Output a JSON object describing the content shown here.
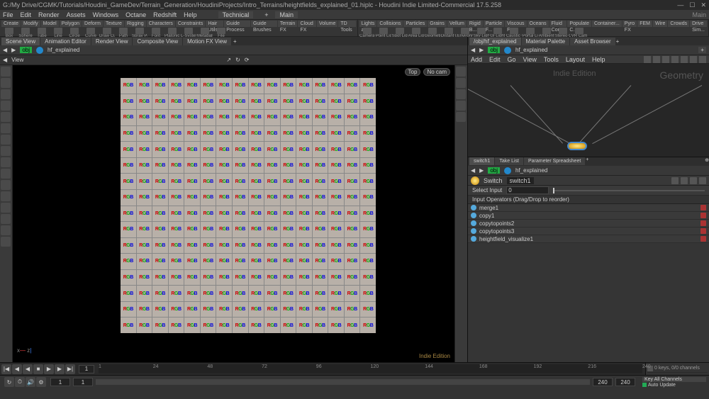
{
  "title": "G:/My Drive/CGMK/Tutorials/Houdini_GameDev/Terrain_Generation/HoudiniProjects/Intro_Terrains/heightfields_explained_01.hiplc - Houdini Indie Limited-Commercial 17.5.258",
  "version_label": "Main",
  "menus": [
    "File",
    "Edit",
    "Render",
    "Assets",
    "Windows",
    "Octane",
    "Redshift",
    "Help"
  ],
  "menu_extra": "Technical",
  "menu_main": "Main",
  "shelf1_tabs": [
    "Create",
    "Modify",
    "Model",
    "Polygon",
    "Deform",
    "Texture",
    "Rigging",
    "Characters",
    "Constraints",
    "Hair Utils",
    "Guide Process",
    "Guide Brushes",
    "Terrain FX",
    "Cloud FX",
    "Volume",
    "TD Tools"
  ],
  "shelf1_items": [
    "Box",
    "Sphere",
    "Tube",
    "Line",
    "Circle",
    "Curve",
    "Draw Curve",
    "Path",
    "Spray Paint",
    "Font",
    "Platonic Solids",
    "L-System",
    "Metaball",
    "File"
  ],
  "shelf2_tabs": [
    "Lights a...",
    "Collisions",
    "Particles",
    "Grains",
    "Vellum",
    "Rigid B...",
    "Particle F...",
    "Viscous F...",
    "Oceans",
    "Fluid Con...",
    "Populate C...",
    "Container...",
    "Pyro FX",
    "FEM",
    "Wire",
    "Crowds",
    "Drive Sim..."
  ],
  "shelf2_items": [
    "Camera",
    "Point Light",
    "Spot Light",
    "Area Light",
    "Geometry Light",
    "Distant Light",
    "Environment Light",
    "Sky Light",
    "GI Light",
    "Caustic Light",
    "Portal Light",
    "Ambient Light",
    "Stereo Camera",
    "VR Camera"
  ],
  "left_tabs": [
    "Scene View",
    "Animation Editor",
    "Render View",
    "Composite View",
    "Motion FX View"
  ],
  "path_obj": "obj",
  "path_node": "hf_explained",
  "view_label": "View",
  "vp_top": "Top",
  "vp_cam": "No cam",
  "watermark": "Indie Edition",
  "net_tabs": [
    "/obj/hf_explained",
    "Material Palette",
    "Asset Browser"
  ],
  "net_menus": [
    "Add",
    "Edit",
    "Go",
    "View",
    "Tools",
    "Layout",
    "Help"
  ],
  "net_wm": "Geometry",
  "net_wm2": "Indie Edition",
  "param_tabs": [
    "switch1",
    "Take List",
    "Parameter Spreadsheet"
  ],
  "node_type": "Switch",
  "node_name": "switch1",
  "param_label": "Select Input",
  "param_val": "0",
  "inputs_label": "Input Operators (Drag/Drop to reorder)",
  "inp": [
    "merge1",
    "copy1",
    "copytopoints2",
    "copytopoints3",
    "heightfield_visualize1"
  ],
  "ticks": [
    "1",
    "24",
    "48",
    "72",
    "96",
    "120",
    "144",
    "168",
    "192",
    "216",
    "240"
  ],
  "frame": "1",
  "range_a": "1",
  "range_b": "1",
  "end1": "240",
  "end2": "240",
  "keys_label": "0 keys, 0/0 channels",
  "keyall": "Key All Channels",
  "autoupdate": "Auto Update"
}
